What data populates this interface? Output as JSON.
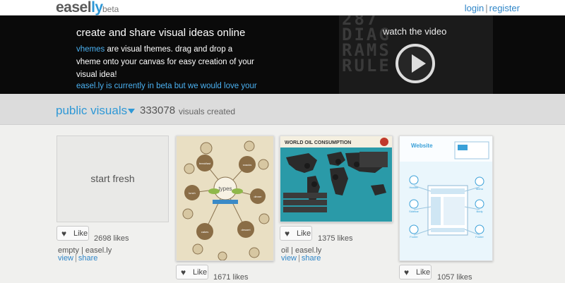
{
  "header": {
    "logo_main": "easel",
    "logo_accent": "ly",
    "logo_suffix": "beta",
    "login": "login",
    "separator": "|",
    "register": "register"
  },
  "hero": {
    "title": "create and share visual ideas online",
    "keyword": "vhemes",
    "description_rest": " are visual themes. drag and drop a vheme onto your canvas for easy creation of your visual idea!",
    "note": "easel.ly is currently in beta but we would love your",
    "video_label": "watch the video",
    "video_bg_lines": [
      "287",
      "DIAG",
      "RAMS",
      "RULE"
    ]
  },
  "section": {
    "title": "public visuals",
    "count": "333078",
    "count_suffix": "visuals created"
  },
  "cards": [
    {
      "label": "start fresh",
      "like": "Like",
      "likes": "2698 likes",
      "meta": "empty | easel.ly",
      "view": "view",
      "share": "share"
    },
    {
      "like": "Like",
      "likes": "1671 likes",
      "center_label": "types",
      "bubbles": [
        "breakfast",
        "lunch",
        "dinner",
        "snacks",
        "dessert",
        "cakes"
      ]
    },
    {
      "like": "Like",
      "likes": "1375 likes",
      "meta": "oil | easel.ly",
      "view": "view",
      "share": "share",
      "banner": "WORLD OIL CONSUMPTION"
    },
    {
      "like": "Like",
      "likes": "1057 likes",
      "banner": "Website",
      "labels": [
        "Header",
        "Sidebar",
        "Footer",
        "Footer",
        "Body",
        "Menu"
      ]
    }
  ],
  "colors": {
    "accent": "#2f98d6",
    "hero_bg": "#0a0a0a",
    "section_bg": "#dcdcdc",
    "oil_sea": "#2a9aa8"
  }
}
